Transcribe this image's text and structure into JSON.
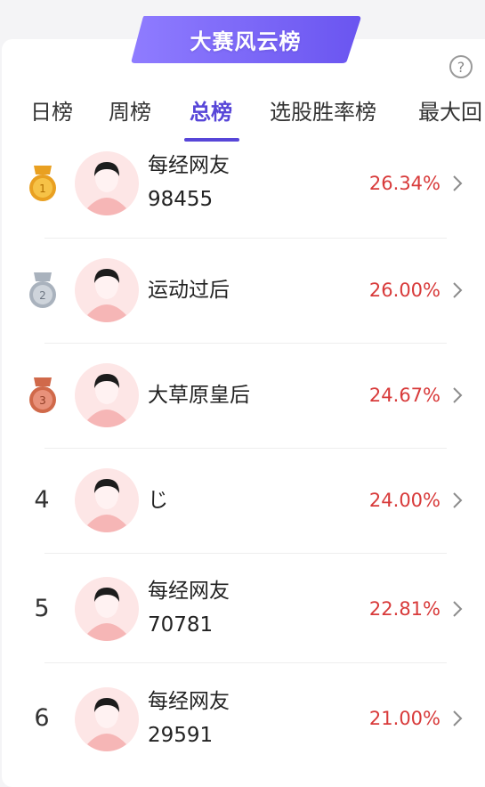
{
  "header": {
    "title": "大赛风云榜",
    "help": "?"
  },
  "tabs": [
    "日榜",
    "周榜",
    "总榜",
    "选股胜率榜",
    "最大回"
  ],
  "active_tab": 2,
  "medal_labels": [
    "1",
    "2",
    "3"
  ],
  "rows": [
    {
      "rank": "1",
      "name_line1": "每经网友",
      "name_line2": "98455",
      "pct": "26.34%"
    },
    {
      "rank": "2",
      "name_line1": "运动过后",
      "name_line2": "",
      "pct": "26.00%"
    },
    {
      "rank": "3",
      "name_line1": "大草原皇后",
      "name_line2": "",
      "pct": "24.67%"
    },
    {
      "rank": "4",
      "name_line1": "じ",
      "name_line2": "",
      "pct": "24.00%"
    },
    {
      "rank": "5",
      "name_line1": "每经网友",
      "name_line2": "70781",
      "pct": "22.81%"
    },
    {
      "rank": "6",
      "name_line1": "每经网友",
      "name_line2": "29591",
      "pct": "21.00%"
    }
  ],
  "colors": {
    "accent": "#5746d8",
    "percent": "#d83a3a",
    "gold": "#e9a021",
    "silver": "#a9b2bd",
    "bronze": "#d0694a"
  }
}
